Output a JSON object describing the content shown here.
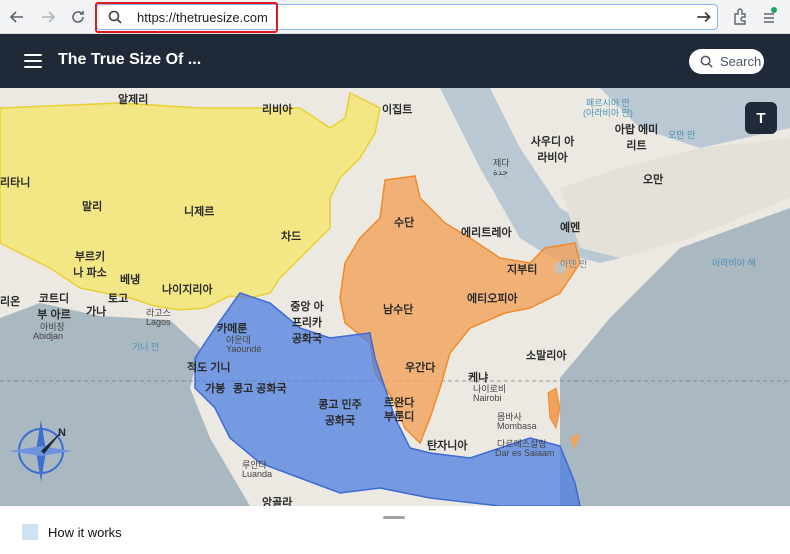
{
  "browser": {
    "url": "https://thetruesize.com"
  },
  "header": {
    "title": "The True Size Of ...",
    "search_label": "Search",
    "t_button": "T"
  },
  "map": {
    "labels": {
      "algeria": "알제리",
      "libya": "리비아",
      "egypt": "이집트",
      "mauritania": "리타니",
      "mali": "말리",
      "niger": "니제르",
      "chad": "차드",
      "sudan": "수단",
      "saudi": "사우디 아라비아",
      "yemen": "예멘",
      "oman": "오만",
      "uae": "아랍 에미리트",
      "eritrea": "에리트레아",
      "djibouti": "지부티",
      "burkina": "부르키나 파소",
      "benin": "베냉",
      "togo": "토고",
      "nigeria": "나이지리아",
      "ivory": "코트디부 아르",
      "ghana": "가나",
      "guinea_w": "리온",
      "car": "중앙 아프리카 공화국",
      "south_sudan": "남수단",
      "ethiopia": "에티오피아",
      "cameroon": "카메룬",
      "eq_guinea": "적도 기니",
      "gabon": "가봉",
      "congo": "콩고 공화국",
      "drc": "콩고 민주 공화국",
      "uganda": "우간다",
      "kenya": "케냐",
      "somalia": "소말리아",
      "rwanda": "르완다",
      "burundi": "부룬디",
      "tanzania": "탄자니아",
      "angola": "앙골라"
    },
    "small": {
      "jeddah_ko": "제다",
      "jeddah_ar": "جدة",
      "lagos_ko": "라고스",
      "lagos": "Lagos",
      "abidjan_ko": "아비장",
      "abidjan": "Abidjan",
      "yaounde_ko": "야운데",
      "yaounde": "Yaoundé",
      "nairobi_ko": "나이로비",
      "nairobi": "Nairobi",
      "mombasa_ko": "몸바사",
      "mombasa": "Mombasa",
      "dar_ko": "다르에스살람",
      "dar": "Dar es Salaam",
      "luanda_ko": "루안다",
      "luanda": "Luanda",
      "aden_ko": "아덴 만"
    },
    "seas": {
      "persian": "페르시아 만",
      "persian2": "(아라비아 만)",
      "oman_gulf": "오만 만",
      "arabian_sea": "아라비아 해",
      "guinea_gulf": "기니 만"
    }
  },
  "bottom": {
    "how_it_works": "How it works"
  },
  "colors": {
    "header_bg": "#1f2937",
    "overlay_yellow": "#f5e56b",
    "overlay_orange": "#f2a35a",
    "overlay_blue": "#4f7fe0",
    "highlight_red": "#e0191e"
  }
}
